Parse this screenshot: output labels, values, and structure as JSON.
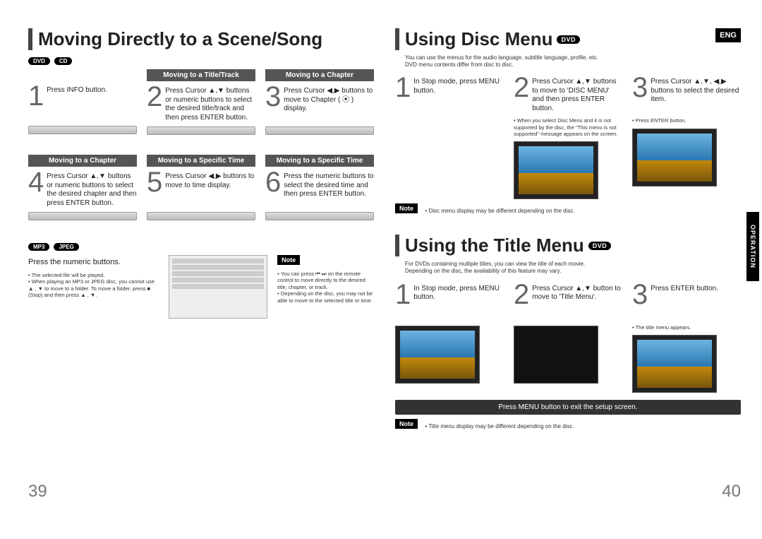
{
  "left": {
    "title": "Moving Directly to a Scene/Song",
    "pills_top": [
      "DVD",
      "CD"
    ],
    "row1": {
      "h1": "",
      "h2": "Moving to a Title/Track",
      "h3": "Moving to a Chapter",
      "s1": "Press INFO button.",
      "s2": "Press Cursor ▲,▼ buttons or numeric buttons to select the desired title/track and then press ENTER button.",
      "s3": "Press Cursor ◀,▶ buttons to move to Chapter ( ⦿ ) display."
    },
    "row2": {
      "h1": "Moving to a Chapter",
      "h2": "Moving to a Specific Time",
      "h3": "Moving to a Specific Time",
      "s4": "Press Cursor ▲,▼ buttons or numeric buttons to select the desired chapter and then press ENTER button.",
      "s5": "Press Cursor ◀,▶ buttons to move to time display.",
      "s6": "Press the numeric buttons to select the desired time and then press ENTER button."
    },
    "pills_bottom": [
      "MP3",
      "JPEG"
    ],
    "mp3_text": "Press the numeric buttons.",
    "mp3_bullets": "• The selected file will be played.\n• When playing an MP3 or JPEG disc, you cannot use ▲ , ▼ to move to a folder. To move a folder, press ■ (Stop) and then press ▲ , ▼.",
    "note_label": "Note",
    "note_text": "• You can press ⏮ ⏭ on the remote control to move directly to the desired title, chapter, or track.\n• Depending on the disc, you may not be able to move to the selected title or time.",
    "page": "39"
  },
  "right": {
    "title1": "Using Disc Menu",
    "title1_pill": "DVD",
    "eng": "ENG",
    "operation": "OPERATION",
    "intro1": "You can use the menus for the audio language, subtitle language, profile, etc.\nDVD menu contents differ from disc to disc.",
    "disc_row": {
      "s1": "In Stop mode, press MENU button.",
      "s2": "Press Cursor ▲,▼ buttons to move to 'DISC MENU' and then press ENTER button.",
      "s3": "Press Cursor ▲,▼, ◀,▶ buttons to select the desired item."
    },
    "disc_bullets2": "• When you select Disc Menu and it is not supported by the disc, the \"This menu is not supported\" message appears on the screen.",
    "disc_bullets3": "• Press ENTER button.",
    "note_label": "Note",
    "disc_note": "• Disc menu display may be different depending on the disc.",
    "title2": "Using the Title Menu",
    "title2_pill": "DVD",
    "intro2": "For DVDs containing multiple titles, you can view the title of each movie.\nDepending on the disc, the availability of this feature may vary.",
    "title_row": {
      "s1": "In Stop mode, press MENU button.",
      "s2": "Press Cursor ▲,▼ button to move to 'Title Menu'.",
      "s3": "Press ENTER button."
    },
    "title_bullets3": "• The title menu appears.",
    "footer": "Press MENU button to exit the setup screen.",
    "title_note": "• Title menu display may be different depending on the disc.",
    "page": "40"
  }
}
